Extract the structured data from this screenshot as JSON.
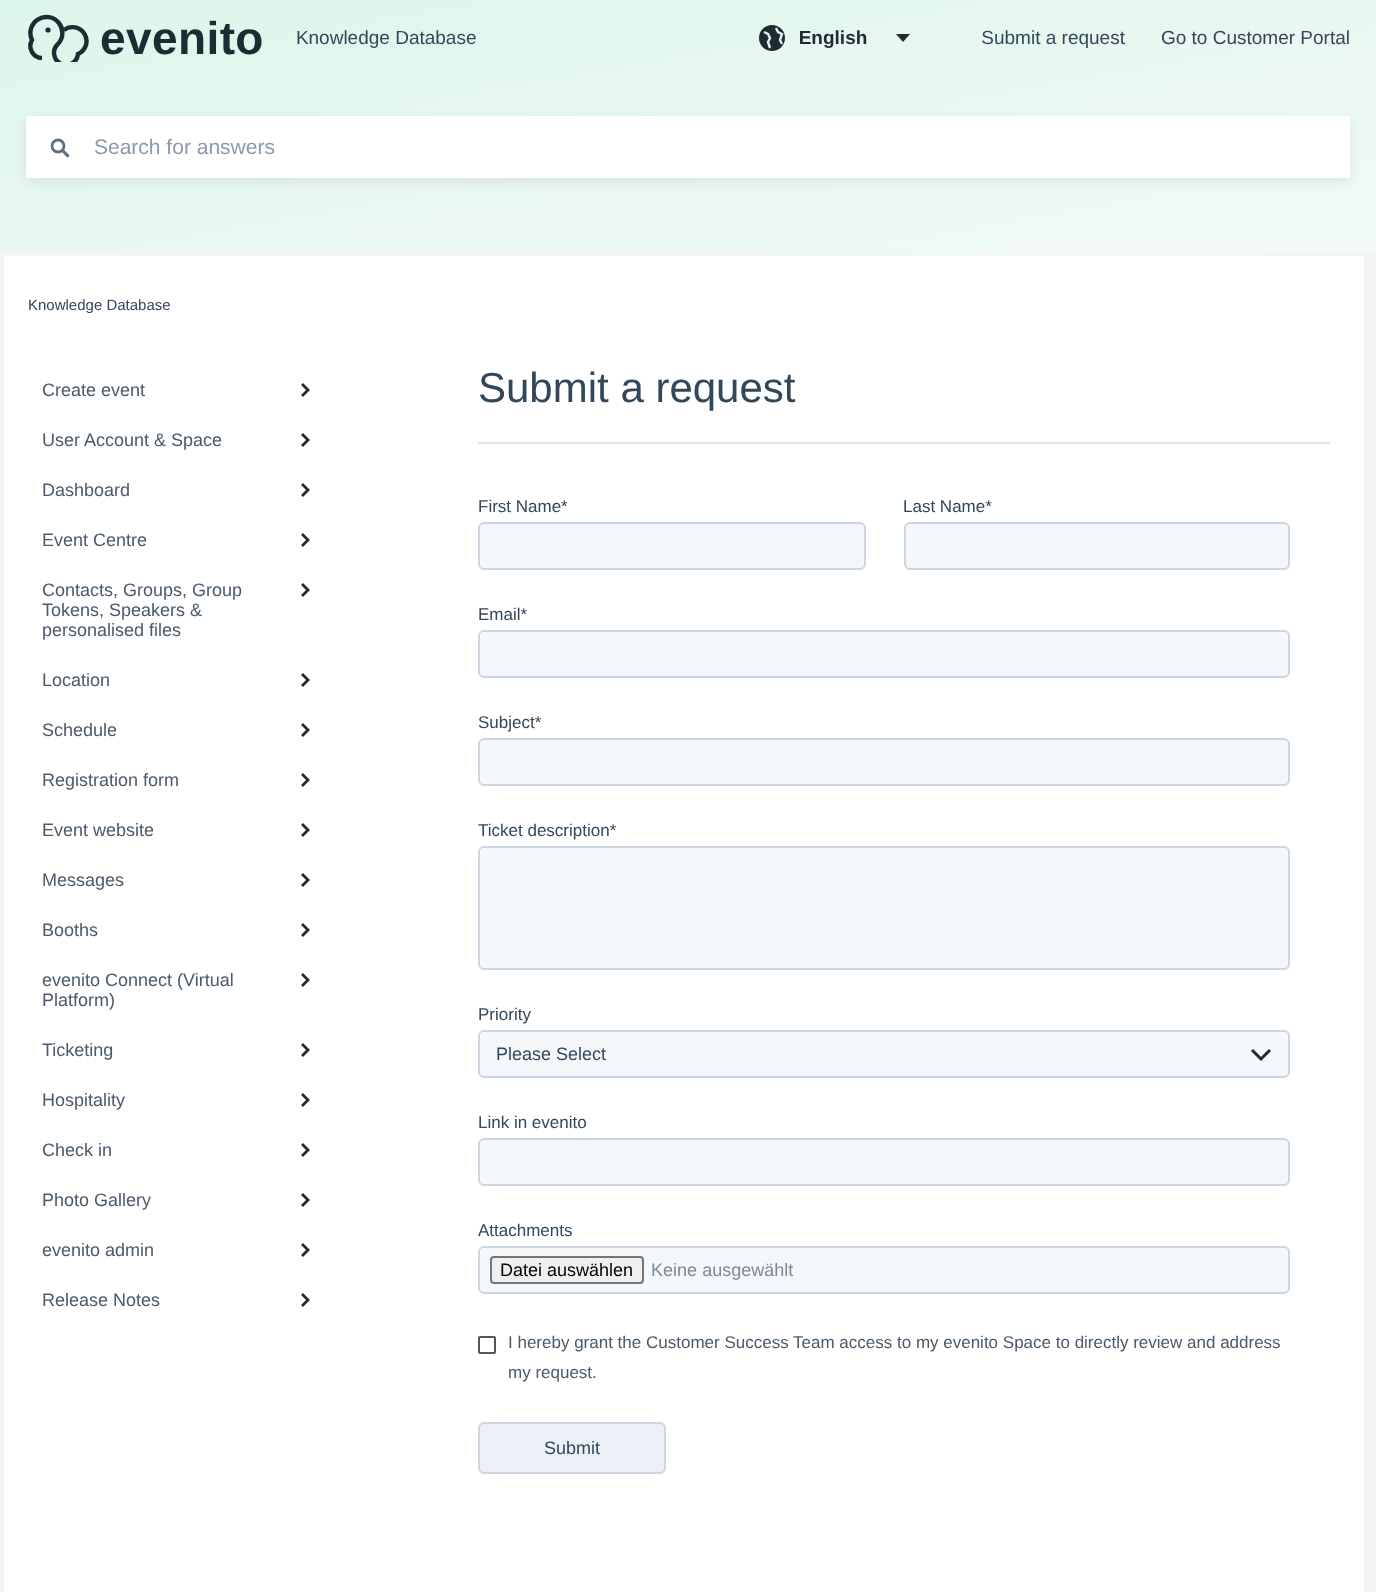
{
  "header": {
    "logo": "evenito",
    "brand_link": "Knowledge Database",
    "language": "English",
    "links": [
      "Submit a request",
      "Go to Customer Portal"
    ]
  },
  "search": {
    "placeholder": "Search for answers"
  },
  "breadcrumb": "Knowledge Database",
  "sidebar": {
    "items": [
      {
        "label": "Create event"
      },
      {
        "label": "User Account & Space"
      },
      {
        "label": "Dashboard"
      },
      {
        "label": "Event Centre"
      },
      {
        "label": "Contacts, Groups, Group Tokens, Speakers & personalised files"
      },
      {
        "label": "Location"
      },
      {
        "label": "Schedule"
      },
      {
        "label": "Registration form"
      },
      {
        "label": "Event website"
      },
      {
        "label": "Messages"
      },
      {
        "label": "Booths"
      },
      {
        "label": "evenito Connect (Virtual Platform)"
      },
      {
        "label": "Ticketing"
      },
      {
        "label": "Hospitality"
      },
      {
        "label": "Check in"
      },
      {
        "label": "Photo Gallery"
      },
      {
        "label": "evenito admin"
      },
      {
        "label": "Release Notes"
      }
    ]
  },
  "form": {
    "title": "Submit a request",
    "rows": [
      {
        "fields": [
          {
            "kind": "text",
            "label": "First Name*"
          },
          {
            "kind": "text",
            "label": "Last Name*"
          }
        ]
      },
      {
        "fields": [
          {
            "kind": "text",
            "label": "Email*"
          }
        ]
      },
      {
        "fields": [
          {
            "kind": "text",
            "label": "Subject*"
          }
        ]
      },
      {
        "fields": [
          {
            "kind": "textarea",
            "label": "Ticket description*"
          }
        ]
      },
      {
        "fields": [
          {
            "kind": "select",
            "label": "Priority",
            "value": "Please Select"
          }
        ]
      },
      {
        "fields": [
          {
            "kind": "text",
            "label": "Link in evenito"
          }
        ]
      },
      {
        "fields": [
          {
            "kind": "file",
            "label": "Attachments",
            "button": "Datei auswählen",
            "status": "Keine ausgewählt"
          }
        ]
      }
    ],
    "consent": {
      "checked": false,
      "text": "I hereby grant the Customer Success Team access to my evenito Space to directly review and address my request."
    },
    "submit": "Submit"
  }
}
